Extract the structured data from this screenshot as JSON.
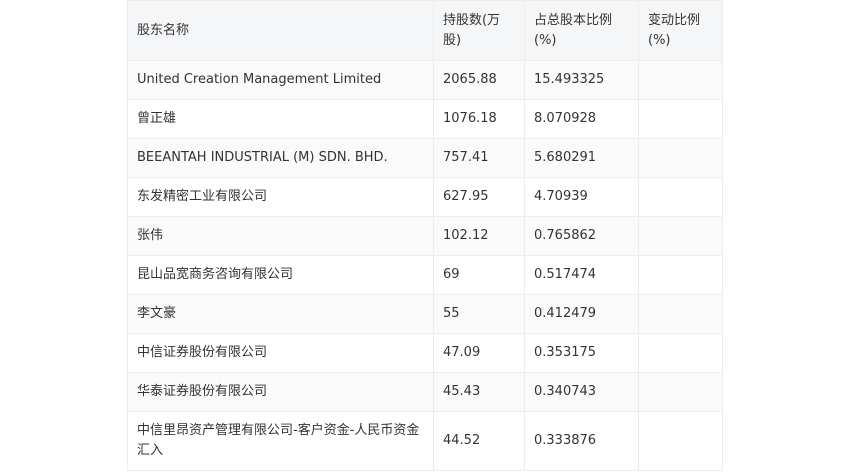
{
  "table": {
    "headers": [
      "股东名称",
      "持股数(万股)",
      "占总股本比例(%)",
      "变动比例(%)"
    ],
    "rows": [
      {
        "name": "United Creation Management Limited",
        "shares": "2065.88",
        "ratio": "15.493325",
        "change": ""
      },
      {
        "name": "曾正雄",
        "shares": "1076.18",
        "ratio": "8.070928",
        "change": ""
      },
      {
        "name": "BEEANTAH INDUSTRIAL (M) SDN. BHD.",
        "shares": "757.41",
        "ratio": "5.680291",
        "change": ""
      },
      {
        "name": "东发精密工业有限公司",
        "shares": "627.95",
        "ratio": "4.70939",
        "change": ""
      },
      {
        "name": "张伟",
        "shares": "102.12",
        "ratio": "0.765862",
        "change": ""
      },
      {
        "name": "昆山品宽商务咨询有限公司",
        "shares": "69",
        "ratio": "0.517474",
        "change": ""
      },
      {
        "name": "李文豪",
        "shares": "55",
        "ratio": "0.412479",
        "change": ""
      },
      {
        "name": "中信证券股份有限公司",
        "shares": "47.09",
        "ratio": "0.353175",
        "change": ""
      },
      {
        "name": "华泰证券股份有限公司",
        "shares": "45.43",
        "ratio": "0.340743",
        "change": ""
      },
      {
        "name": "中信里昂资产管理有限公司-客户资金-人民币资金汇入",
        "shares": "44.52",
        "ratio": "0.333876",
        "change": ""
      }
    ]
  }
}
